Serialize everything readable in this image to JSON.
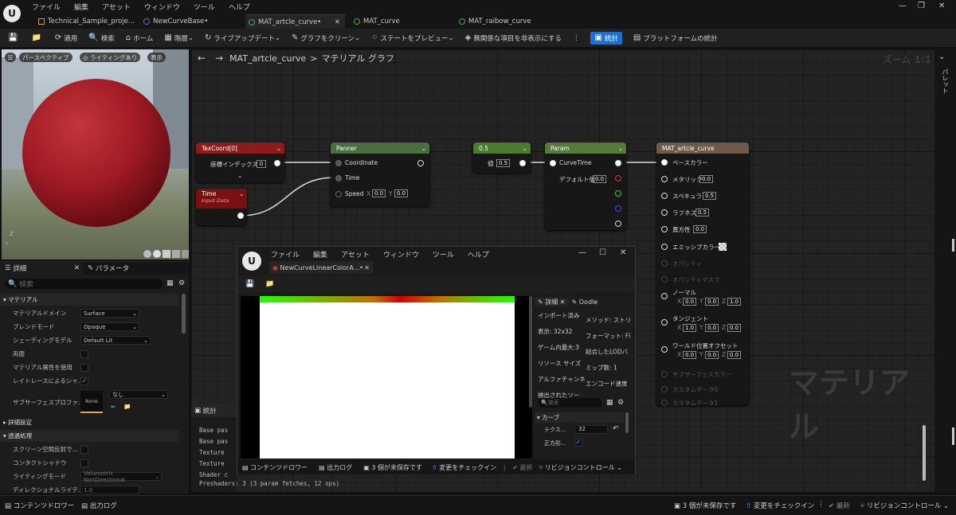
{
  "menu": [
    "ファイル",
    "編集",
    "アセット",
    "ウィンドウ",
    "ツール",
    "ヘルプ"
  ],
  "doc_tabs": [
    "Technical_Sample_proje...",
    "NewCurveBase•",
    "MAT_artcle_curve•",
    "MAT_curve",
    "MAT_raibow_curve"
  ],
  "toolbar": {
    "apply": "適用",
    "search": "検索",
    "home": "ホーム",
    "hierarchy": "階層",
    "live_update": "ライブアップデート",
    "clean_graph": "グラフをクリーン",
    "preview_state": "ステートをプレビュー",
    "hide_unrelated": "無関係な項目を非表示にする",
    "stats": "統計",
    "platform_stats": "プラットフォームの統計"
  },
  "viewport": {
    "perspective": "パースペクティブ",
    "lighting": "ライティングあり",
    "show": "表示",
    "axis_x": "X",
    "axis_z": "Z"
  },
  "details": {
    "tab_details": "詳細",
    "tab_params": "パラメータ",
    "search_placeholder": "検索",
    "section_material": "マテリアル",
    "rows": [
      {
        "label": "マテリアルドメイン",
        "value": "Surface"
      },
      {
        "label": "ブレンドモード",
        "value": "Opaque"
      },
      {
        "label": "シェーディングモデル",
        "value": "Default Lit"
      },
      {
        "label": "両面",
        "value": ""
      },
      {
        "label": "マテリアル属性を使用",
        "value": ""
      },
      {
        "label": "レイトレースによるシャ...",
        "value": ""
      }
    ],
    "subsurface_label": "サブサーフェスプロファ...",
    "subsurface_none": "None",
    "subsurface_select": "なし",
    "advanced": "詳細設定",
    "section_translucency": "透過処理",
    "trans_rows": [
      {
        "label": "スクリーン空間反射で...",
        "value": ""
      },
      {
        "label": "コンタクトシャドウ",
        "value": ""
      },
      {
        "label": "ライティングモード",
        "value": "Volumetric NonDirectional"
      },
      {
        "label": "ディレクショナルライテ...",
        "value": "1.0"
      }
    ]
  },
  "graph": {
    "breadcrumb_asset": "MAT_artcle_curve",
    "breadcrumb_sep": ">",
    "breadcrumb_graph": "マテリアル グラフ",
    "zoom": "ズーム 1:1",
    "watermark": "マテリアル",
    "nodes": {
      "texcoord": {
        "title": "TexCoord[0]",
        "label": "座標インデックス",
        "value": "0"
      },
      "time": {
        "title": "Time",
        "subtitle": "Input Data"
      },
      "panner": {
        "title": "Panner",
        "in1": "Coordinate",
        "in2": "Time",
        "in3": "Speed",
        "sx": "X",
        "sxv": "0.0",
        "sy": "Y",
        "syv": "0.0"
      },
      "const": {
        "title": "0.5",
        "label": "値",
        "value": "0.5"
      },
      "param": {
        "title": "Param",
        "in": "CurveTime",
        "default_label": "デフォルト値",
        "default_value": "0.0"
      },
      "result": {
        "title": "MAT_artcle_curve",
        "pins": [
          {
            "label": "ベースカラー",
            "value": ""
          },
          {
            "label": "メタリック",
            "value": "0.0"
          },
          {
            "label": "スペキュラ",
            "value": "0.5"
          },
          {
            "label": "ラフネス",
            "value": "0.5"
          },
          {
            "label": "異方性",
            "value": "0.0"
          },
          {
            "label": "エミッシブカラー",
            "value": ""
          },
          {
            "label": "オパシティ",
            "value": ""
          },
          {
            "label": "オパシティマスク",
            "value": ""
          }
        ],
        "normal": {
          "label": "ノーマル",
          "x": "0.0",
          "y": "0.0",
          "z": "1.0"
        },
        "tangent": {
          "label": "タンジェント",
          "x": "1.0",
          "y": "0.0",
          "z": "0.0"
        },
        "wpo": {
          "label": "ワールド位置オフセット",
          "x": "0.0",
          "y": "0.0",
          "z": "0.0"
        },
        "subsurface": "サブサーフェスカラー",
        "custom0": "カスタムデータ0",
        "custom1": "カスタムデータ1",
        "ax": "X",
        "ay": "Y",
        "az": "Z"
      }
    }
  },
  "stats": {
    "title": "統計",
    "lines": [
      "Base pas",
      "Base pas",
      "Texture",
      "Texture",
      "Shader c",
      "Preshaders: 3  (3 param fetches, 12 ops)"
    ]
  },
  "curve_window": {
    "menu": [
      "ファイル",
      "編集",
      "アセット",
      "ウィンドウ",
      "ツール",
      "ヘルプ"
    ],
    "tab": "NewCurveLinearColorA...•",
    "details_tab": "詳細",
    "oodle_tab": "Oodle",
    "info": [
      [
        "インポート済み",
        "メソッド: ストリ"
      ],
      [
        "表示: 32x32",
        "フォーマット: Fl"
      ],
      [
        "ゲーム内最大:3",
        "結合したLODバ"
      ],
      [
        "リソース サイズ",
        "ミップ数: 1"
      ],
      [
        "アルファチャンネ",
        "エンコード速度"
      ],
      [
        "検出されたソー",
        ""
      ]
    ],
    "search_placeholder": "検索",
    "curve_section": "カーブ",
    "tex_label": "テクス...",
    "tex_value": "32",
    "sq_label": "正方形...",
    "bottom": [
      "コンテンツドロワー",
      "出力ログ",
      "3 個が未保存です",
      "変更をチェックイン",
      "最新",
      "リビジョンコントロール"
    ]
  },
  "right_panel": "パレット",
  "statusbar": {
    "content_drawer": "コンテンツドロワー",
    "output_log": "出力ログ",
    "unsaved": "3 個が未保存です",
    "checkin": "変更をチェックイン",
    "latest": "最新",
    "revision": "リビジョンコントロール"
  },
  "colors": {
    "accent": "#1e6fd0",
    "texcoord_header": "#8a1c1c",
    "time_header": "#7a1010",
    "panner_header": "#4b6e41",
    "const_header": "#4c7a2e",
    "param_header": "#557a3a",
    "result_header": "#6d5a4a"
  }
}
